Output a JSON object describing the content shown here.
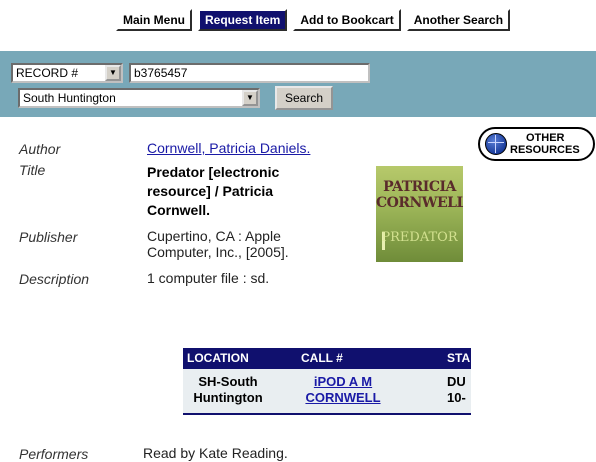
{
  "nav": {
    "main_menu": "Main Menu",
    "request_item": "Request Item",
    "add_to_bookcart": "Add to Bookcart",
    "another_search": "Another Search"
  },
  "search": {
    "type_value": "RECORD #",
    "term_value": "b3765457",
    "location_value": "South Huntington",
    "button_label": "Search"
  },
  "record": {
    "author_label": "Author",
    "author_value": "Cornwell, Patricia Daniels.",
    "title_label": "Title",
    "title_line1": "Predator [electronic",
    "title_line2": "resource] / Patricia",
    "title_line3": "Cornwell.",
    "publisher_label": "Publisher",
    "publisher_line1": "Cupertino, CA : Apple",
    "publisher_line2": "Computer, Inc., [2005].",
    "description_label": "Description",
    "description_value": "1 computer file : sd.",
    "performers_label": "Performers",
    "performers_value": "Read by Kate Reading."
  },
  "cover": {
    "author_line1": "PATRICIA",
    "author_line2": "CORNWELL",
    "title": "PREDATOR"
  },
  "other_resources": {
    "line1": "OTHER",
    "line2": "RESOURCES"
  },
  "holdings": {
    "headers": [
      "LOCATION",
      "CALL #",
      "STA"
    ],
    "row": {
      "location_line1": "SH-South",
      "location_line2": "Huntington",
      "call_line1": "iPOD A M",
      "call_line2": "CORNWELL",
      "status_line1": "DU",
      "status_line2": "10-"
    }
  },
  "colors": {
    "nav_active": "#10106e",
    "search_bar": "#78a8b8",
    "link": "#1a1aa6",
    "table_header": "#10106e"
  }
}
